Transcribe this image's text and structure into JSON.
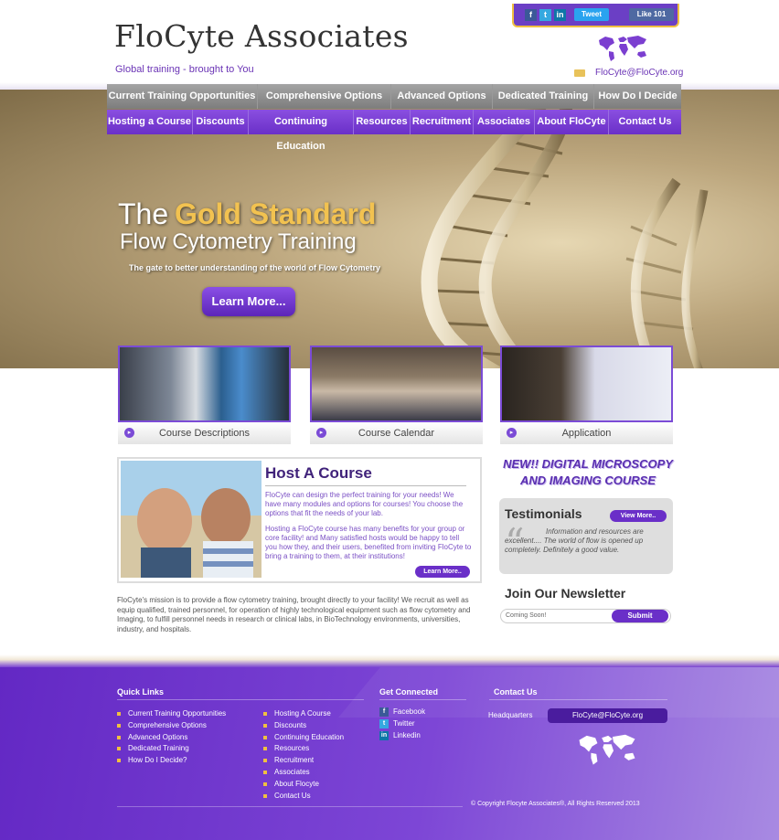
{
  "header": {
    "logo": "FloCyte Associates",
    "tagline": "Global training - brought to You",
    "email": "FloCyte@FloCyte.org",
    "social": {
      "facebook": "f",
      "twitter": "t",
      "linkedin": "in"
    },
    "tweet_label": "Tweet",
    "like_label": "Like 101",
    "colors": {
      "accent": "#6a2fc8",
      "gold": "#f2c250"
    }
  },
  "nav": {
    "primary": [
      "Current Training Opportunities",
      "Comprehensive Options",
      "Advanced Options",
      "Dedicated Training",
      "How Do I Decide"
    ],
    "secondary": [
      "Hosting a Course",
      "Discounts",
      "Continuing Education",
      "Resources",
      "Recruitment",
      "Associates",
      "About FloCyte",
      "Contact Us"
    ]
  },
  "hero": {
    "line1_a": "The",
    "line1_b": "Gold Standard",
    "line2": "Flow Cytometry Training",
    "subtitle": "The gate to better understanding of the world of Flow Cytometry",
    "button": "Learn More..."
  },
  "thumbs": [
    {
      "label": "Course Descriptions"
    },
    {
      "label": "Course Calendar"
    },
    {
      "label": "Application"
    }
  ],
  "host": {
    "title": "Host A Course",
    "p1": "FloCyte can design the perfect training for your needs! We have many modules and options for courses! You choose the options that fit the needs of your lab.",
    "p2": "Hosting a FloCyte course has many benefits for your group or core facility! and Many satisfied hosts would be happy to tell you how they, and their users, benefited from inviting FloCyte to bring a training to them, at their institutions!",
    "button": "Learn More.."
  },
  "mission": "FloCyte's mission is to provide a flow cytometry training, brought directly to your facility! We recruit as well as equip qualified, trained personnel, for operation of highly technological equipment such as flow cytometry and Imaging, to fulfill personnel needs in research or clinical labs, in BioTechnology environments, universities, industry, and hospitals.",
  "sidebar": {
    "new_course_1": "NEW!! DIGITAL MICROSCOPY",
    "new_course_2": "AND IMAGING COURSE",
    "testimonials_title": "Testimonials",
    "view_more": "View More..",
    "quote": "Information and resources are excellent.... The world of flow is opened up completely. Definitely a good value.",
    "newsletter_title": "Join Our Newsletter",
    "newsletter_value": "Coming Soon!",
    "submit": "Submit"
  },
  "footer": {
    "quick_links_title": "Quick Links",
    "col1": [
      "Current Training Opportunities",
      "Comprehensive Options",
      "Advanced Options",
      "Dedicated Training",
      "How Do I Decide?"
    ],
    "col2": [
      "Hosting A Course",
      "Discounts",
      "Continuing Education",
      "Resources",
      "Recruitment",
      "Associates",
      "About Flocyte",
      "Contact Us"
    ],
    "connected_title": "Get Connected",
    "connected": [
      "Facebook",
      "Twitter",
      "Linkedin"
    ],
    "contact_title": "Contact Us",
    "hq_label": "Headquarters",
    "hq_email": "FloCyte@FloCyte.org",
    "copyright": "© Copyright Flocyte Associates®, All Rights Reserved 2013"
  }
}
